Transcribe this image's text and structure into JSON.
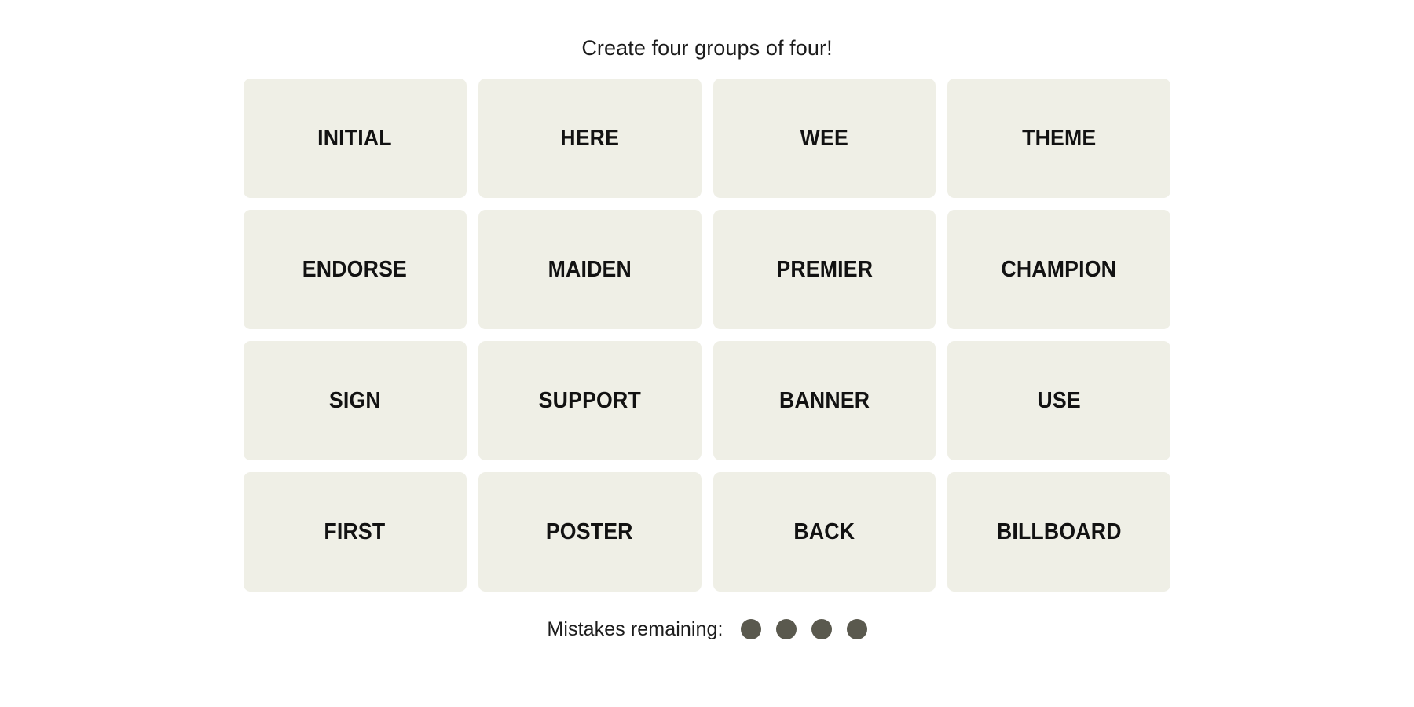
{
  "page": {
    "background_color": "#ffffff",
    "title": "Create four groups of four!"
  },
  "theme": {
    "tile_background": "#efefe6",
    "tile_text_color": "#121212",
    "title_text_color": "#1c1c1c",
    "dot_color": "#5a594e"
  },
  "board": {
    "rows": 4,
    "columns": 4,
    "tiles": [
      {
        "label": "INITIAL"
      },
      {
        "label": "HERE"
      },
      {
        "label": "WEE"
      },
      {
        "label": "THEME"
      },
      {
        "label": "ENDORSE"
      },
      {
        "label": "MAIDEN"
      },
      {
        "label": "PREMIER"
      },
      {
        "label": "CHAMPION"
      },
      {
        "label": "SIGN"
      },
      {
        "label": "SUPPORT"
      },
      {
        "label": "BANNER"
      },
      {
        "label": "USE"
      },
      {
        "label": "FIRST"
      },
      {
        "label": "POSTER"
      },
      {
        "label": "BACK"
      },
      {
        "label": "BILLBOARD"
      }
    ]
  },
  "mistakes": {
    "label": "Mistakes remaining:",
    "remaining": 4,
    "total": 4
  }
}
